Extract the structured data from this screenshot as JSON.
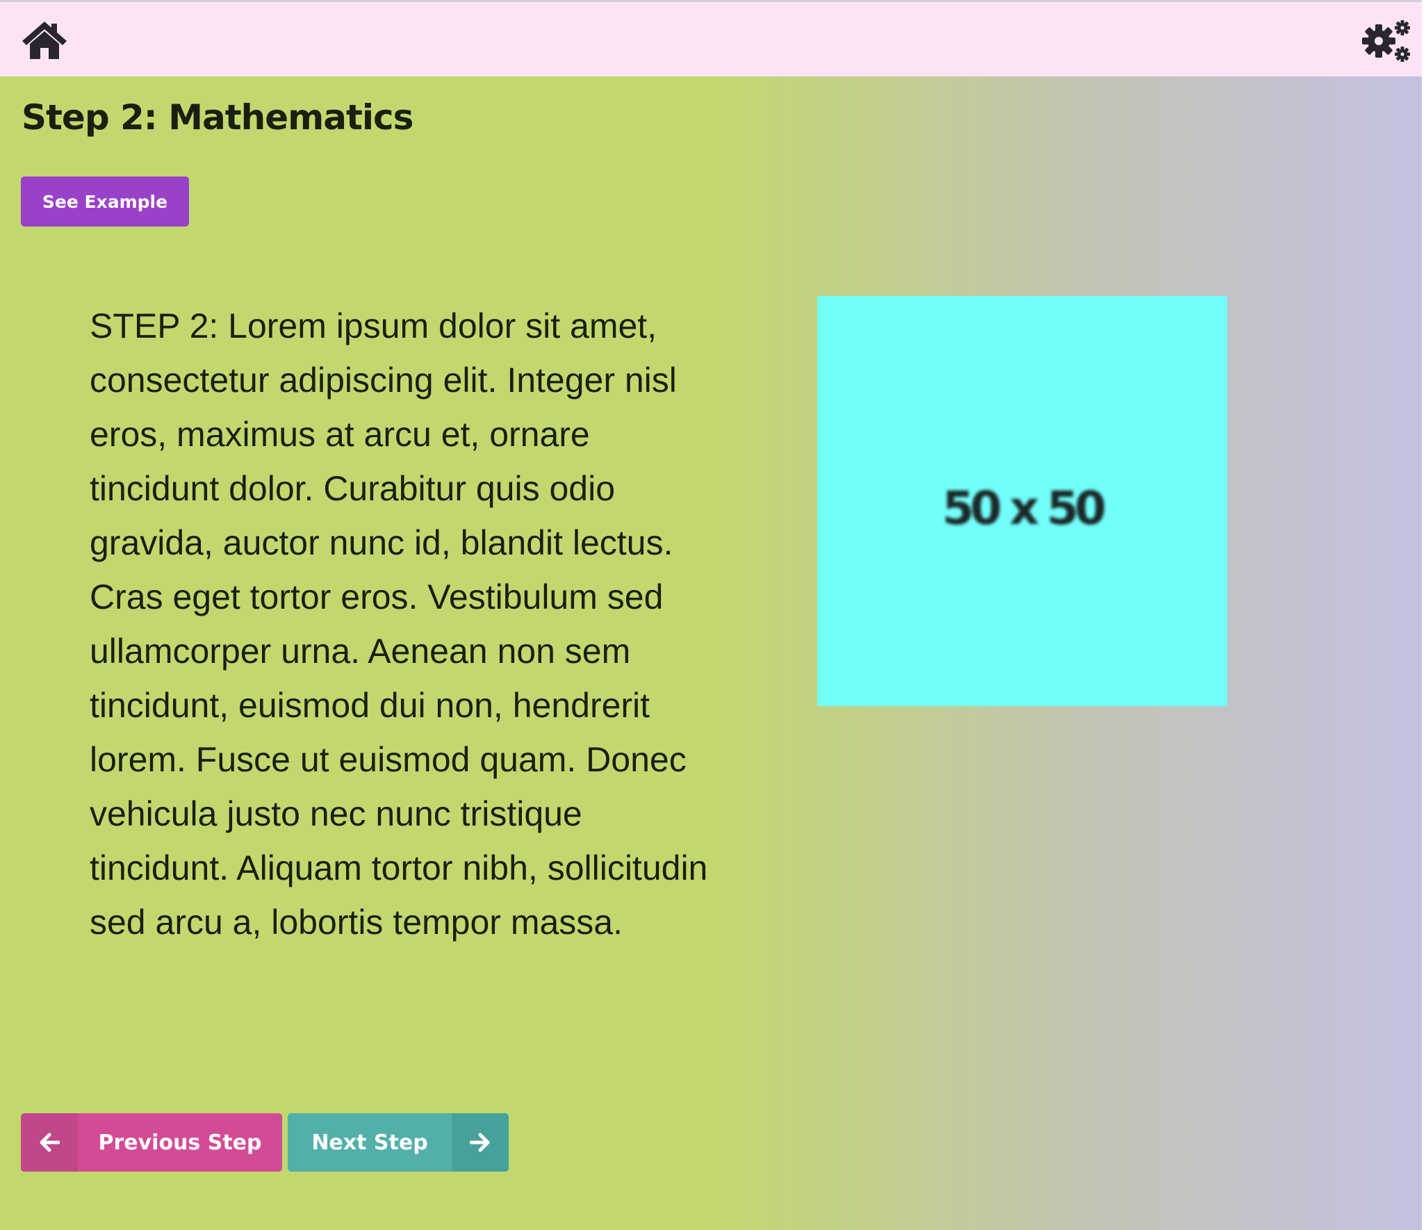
{
  "header": {
    "home_icon": "home-icon",
    "settings_icon": "gears-icon"
  },
  "page": {
    "title": "Step 2: Mathematics",
    "see_example_label": "See Example",
    "body_text": "STEP 2: Lorem ipsum dolor sit amet, consectetur adipiscing elit. Integer nisl eros, maximus at arcu et, ornare tincidunt dolor. Curabitur quis odio gravida, auctor nunc id, blandit lectus. Cras eget tortor eros. Vestibulum sed ullamcorper urna. Aenean non sem tincidunt, euismod dui non, hendrerit lorem. Fusce ut euismod quam. Donec vehicula justo nec nunc tristique tincidunt. Aliquam tortor nibh, sollicitudin sed arcu a, lobortis tempor massa.",
    "image_placeholder_label": "50 x 50"
  },
  "navigation": {
    "previous_label": "Previous Step",
    "next_label": "Next Step",
    "previous_icon": "arrow-left-icon",
    "next_icon": "arrow-right-icon"
  },
  "colors": {
    "header_bg": "#fce4f6",
    "see_example_bg": "#9941c9",
    "previous_bg": "#d34b95",
    "next_bg": "#52b0a9",
    "placeholder_bg": "#72fffb",
    "gradient_start": "#c2d86e",
    "gradient_end": "#c3c1e2"
  }
}
